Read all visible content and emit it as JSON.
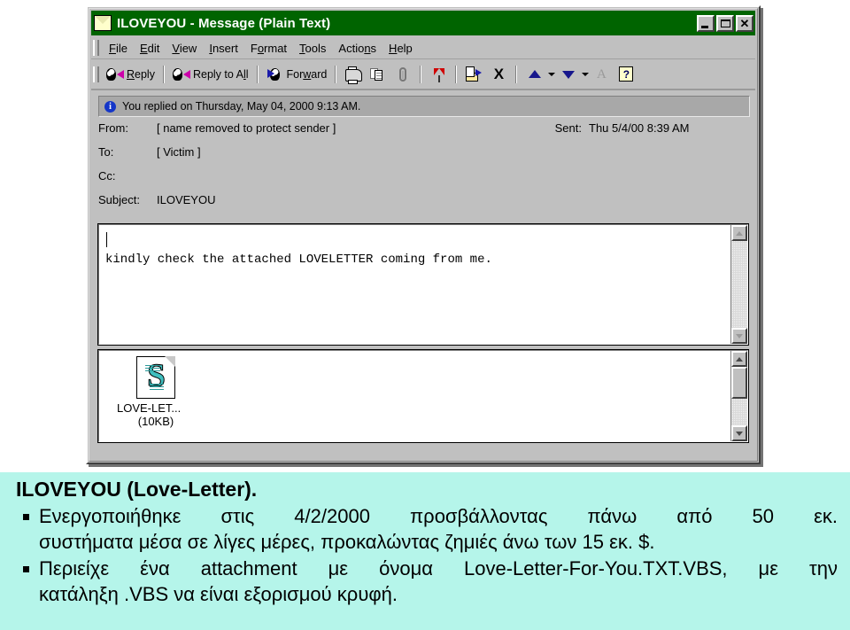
{
  "window": {
    "title": "ILOVEYOU - Message (Plain Text)",
    "title_icon": "envelope-icon",
    "buttons": {
      "minimize": "minimize-icon",
      "maximize": "maximize-icon",
      "close": "close-icon"
    }
  },
  "menubar": [
    {
      "pre": "",
      "accel": "F",
      "post": "ile"
    },
    {
      "pre": "",
      "accel": "E",
      "post": "dit"
    },
    {
      "pre": "",
      "accel": "V",
      "post": "iew"
    },
    {
      "pre": "",
      "accel": "I",
      "post": "nsert"
    },
    {
      "pre": "F",
      "accel": "o",
      "post": "rmat"
    },
    {
      "pre": "",
      "accel": "T",
      "post": "ools"
    },
    {
      "pre": "Actio",
      "accel": "n",
      "post": "s"
    },
    {
      "pre": "",
      "accel": "H",
      "post": "elp"
    }
  ],
  "toolbar": {
    "reply": {
      "pre": "",
      "accel": "R",
      "post": "eply",
      "icon": "reply-icon"
    },
    "reply_all": {
      "pre": "Reply to A",
      "accel": "l",
      "post": "l",
      "icon": "reply-all-icon"
    },
    "forward": {
      "pre": "For",
      "accel": "w",
      "post": "ard",
      "icon": "forward-icon"
    },
    "print": "print-icon",
    "copy": "copy-icon",
    "attach": "paperclip-icon",
    "flag": "flag-icon",
    "move_to_folder": "move-to-folder-icon",
    "delete": "delete-x-icon",
    "previous": "previous-item-arrow-icon",
    "next": "next-item-arrow-icon",
    "font": "font-a-icon",
    "help": "help-question-icon",
    "delete_glyph": "X",
    "font_glyph": "A",
    "help_glyph": "?"
  },
  "infobar": {
    "icon": "info-icon",
    "icon_glyph": "i",
    "text": "You replied on Thursday, May 04, 2000 9:13 AM."
  },
  "header": {
    "from_label": "From:",
    "from_value": "[ name removed to protect sender ]",
    "sent_label": "Sent:",
    "sent_value": "Thu 5/4/00 8:39 AM",
    "to_label": "To:",
    "to_value": "[ Victim ]",
    "cc_label": "Cc:",
    "cc_value": "",
    "subject_label": "Subject:",
    "subject_value": "ILOVEYOU"
  },
  "body": {
    "text": "kindly check the attached LOVELETTER coming from me."
  },
  "attachment": {
    "icon": "vbs-script-file-icon",
    "icon_letter": "S",
    "name": "LOVE-LET...",
    "size": "(10KB)"
  },
  "caption": {
    "title": "ILOVEYOU (Love-Letter).",
    "bullets": [
      "Ενεργοποιήθηκε στις 4/2/2000 προσβάλλοντας πάνω από 50 εκ. συστήματα μέσα σε λίγες μέρες, προκαλώντας ζημιές άνω των 15 εκ. $.",
      "Περιείχε ένα attachment με όνομα Love-Letter-For-You.TXT.VBS, με την κατάληξη .VBS να είναι εξορισμού κρυφή."
    ],
    "bullet1_line1": "Ενεργοποιήθηκε στις 4/2/2000 προσβάλλοντας πάνω από 50 εκ.",
    "bullet1_line2": "συστήματα μέσα σε λίγες μέρες, προκαλώντας ζημιές άνω των 15 εκ. $.",
    "bullet2_line1": "Περιείχε ένα attachment με όνομα Love-Letter-For-You.TXT.VBS, με την",
    "bullet2_line2": "κατάληξη .VBS να είναι εξορισμού κρυφή."
  },
  "colors": {
    "titlebar": "#006400",
    "window_face": "#c0c0c0",
    "caption_bg": "#b5f5ea",
    "infobar_bg": "#a8a8a8",
    "accent_blue": "#16168c"
  }
}
